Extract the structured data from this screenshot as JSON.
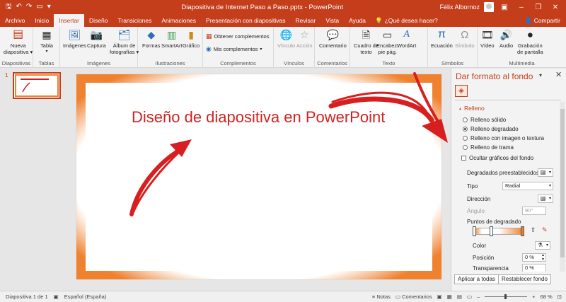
{
  "titlebar": {
    "doc_title": "Diapositiva de Internet Paso a Paso.pptx  -  PowerPoint",
    "user_name": "Félix Albornoz"
  },
  "tabs": [
    {
      "label": "Archivo"
    },
    {
      "label": "Inicio"
    },
    {
      "label": "Insertar"
    },
    {
      "label": "Diseño"
    },
    {
      "label": "Transiciones"
    },
    {
      "label": "Animaciones"
    },
    {
      "label": "Presentación con diapositivas"
    },
    {
      "label": "Revisar"
    },
    {
      "label": "Vista"
    },
    {
      "label": "Ayuda"
    }
  ],
  "tellme": "¿Qué desea hacer?",
  "share": "Compartir",
  "ribbon": {
    "diapositivas": {
      "btn1a": "Nueva",
      "btn1b": "diapositiva ▾",
      "label": "Diapositivas"
    },
    "tablas": {
      "btn": "Tabla",
      "label": "Tablas"
    },
    "imagenes": {
      "btn1": "Imágenes",
      "btn2": "Captura",
      "btn3a": "Álbum de",
      "btn3b": "fotografías ▾",
      "label": "Imágenes"
    },
    "ilustraciones": {
      "btn1": "Formas",
      "btn2": "SmartArt",
      "btn3": "Gráfico",
      "label": "Ilustraciones"
    },
    "complementos": {
      "btn1": "Obtener complementos",
      "btn2": "Mis complementos",
      "label": "Complementos"
    },
    "vinculos": {
      "btn1": "Vínculo",
      "btn2": "Acción",
      "label": "Vínculos"
    },
    "comentarios": {
      "btn": "Comentario",
      "label": "Comentarios"
    },
    "texto": {
      "btn1a": "Cuadro de",
      "btn1b": "texto",
      "btn2a": "Encabez.",
      "btn2b": "pie pág.",
      "btn3": "WordArt",
      "label": "Texto"
    },
    "simbolos": {
      "btn1": "Ecuación",
      "btn2": "Símbolo",
      "label": "Símbolos"
    },
    "multimedia": {
      "btn1": "Vídeo",
      "btn2": "Audio",
      "btn3a": "Grabación",
      "btn3b": "de pantalla",
      "label": "Multimedia"
    }
  },
  "thumbnails": {
    "num": "1"
  },
  "slide": {
    "title": "Diseño de diapositiva en PowerPoint"
  },
  "format_pane": {
    "title": "Dar formato al fondo",
    "section": "Relleno",
    "options": [
      {
        "label": "Relleno sólido"
      },
      {
        "label": "Relleno degradado"
      },
      {
        "label": "Relleno con imagen o textura"
      },
      {
        "label": "Relleno de trama"
      }
    ],
    "hide_graphics": "Ocultar gráficos del fondo",
    "preset_label": "Degradados preestablecidos",
    "type_label": "Tipo",
    "type_value": "Radial",
    "direction_label": "Dirección",
    "angle_label": "Ángulo",
    "angle_value": "90°",
    "stops_label": "Puntos de degradado",
    "color_label": "Color",
    "position_label": "Posición",
    "position_value": "0 %",
    "transparency_label": "Transparencia",
    "transparency_value": "0 %",
    "apply_all": "Aplicar a todas",
    "reset": "Restablecer fondo"
  },
  "statusbar": {
    "slide_info": "Diapositiva 1 de 1",
    "language": "Español (España)",
    "notes": "Notas",
    "comments": "Comentarios",
    "zoom": "68 %"
  },
  "colors": {
    "accent": "#c43e1c",
    "frame_orange": "#f0822f",
    "title_red": "#d22222"
  }
}
